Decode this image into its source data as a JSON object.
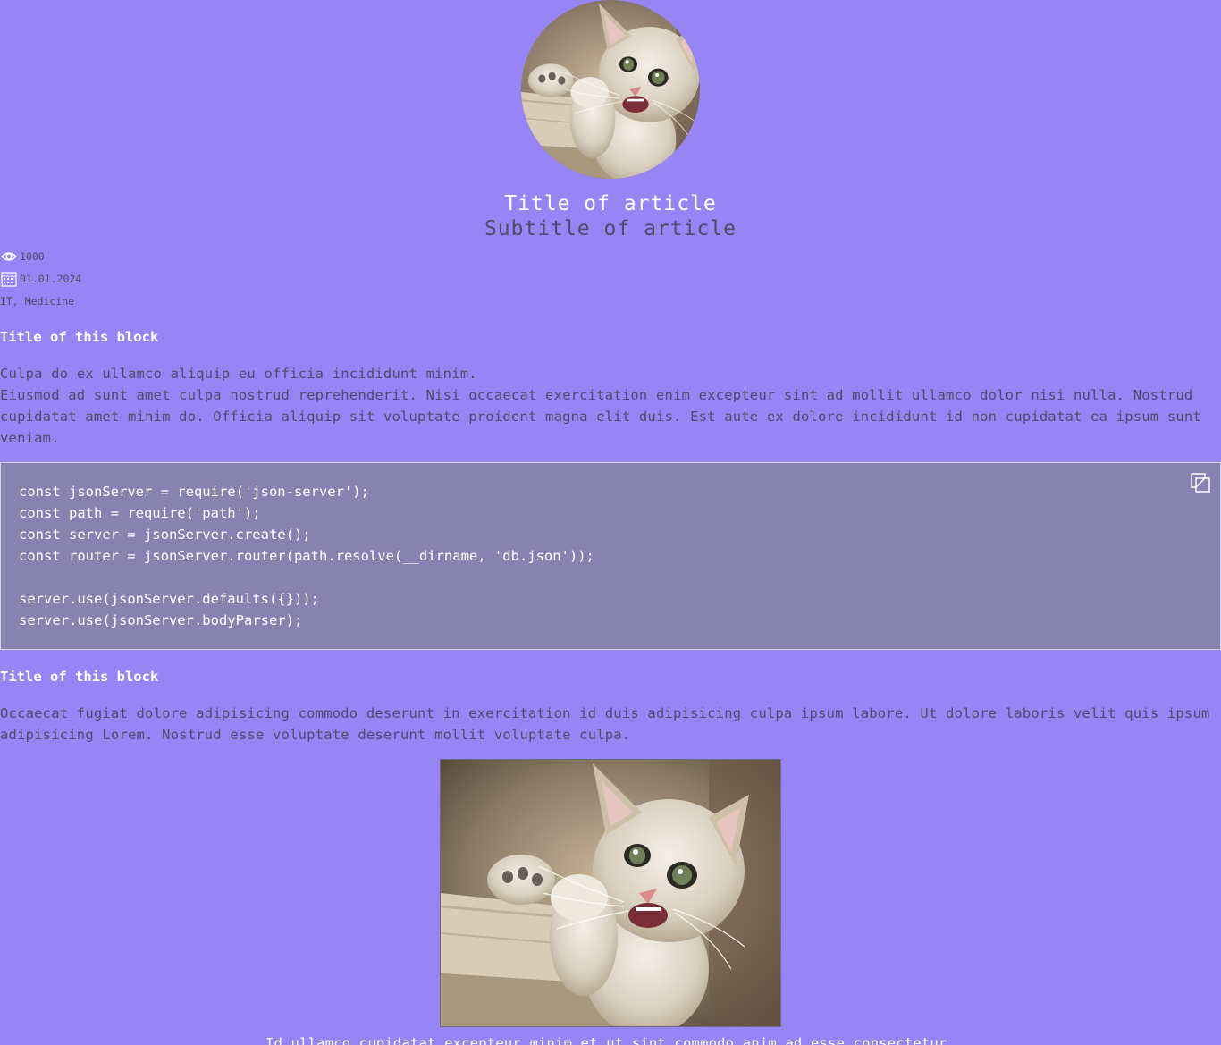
{
  "article": {
    "title": "Title of article",
    "subtitle": "Subtitle of article",
    "views": "1000",
    "date": "01.01.2024",
    "tags": "IT, Medicine"
  },
  "blocks": [
    {
      "title": "Title of this block",
      "paragraphs": [
        "Culpa do ex ullamco aliquip eu officia incididunt minim.",
        "Eiusmod ad sunt amet culpa nostrud reprehenderit. Nisi occaecat exercitation enim excepteur sint ad mollit ullamco dolor nisi nulla. Nostrud cupidatat amet minim do. Officia aliquip sit voluptate proident magna elit duis. Est aute ex dolore incididunt id non cupidatat ea ipsum sunt veniam."
      ]
    },
    {
      "code": "const jsonServer = require('json-server');\nconst path = require('path');\nconst server = jsonServer.create();\nconst router = jsonServer.router(path.resolve(__dirname, 'db.json'));\n\nserver.use(jsonServer.defaults({}));\nserver.use(jsonServer.bodyParser);"
    },
    {
      "title": "Title of this block",
      "paragraphs": [
        "Occaecat fugiat dolore adipisicing commodo deserunt in exercitation id duis adipisicing culpa ipsum labore. Ut dolore laboris velit quis ipsum adipisicing Lorem. Nostrud esse voluptate deserunt mollit voluptate culpa."
      ]
    },
    {
      "caption": "Id ullamco cupidatat excepteur minim et ut sint commodo anim ad esse consectetur."
    }
  ],
  "icons": {
    "views": "eye-icon",
    "date": "calendar-icon",
    "copy": "copy-icon"
  },
  "colors": {
    "background": "#9785f6",
    "code_background": "#8882b0",
    "primary_text": "#ffffff",
    "secondary_text": "#4d4d6b"
  }
}
